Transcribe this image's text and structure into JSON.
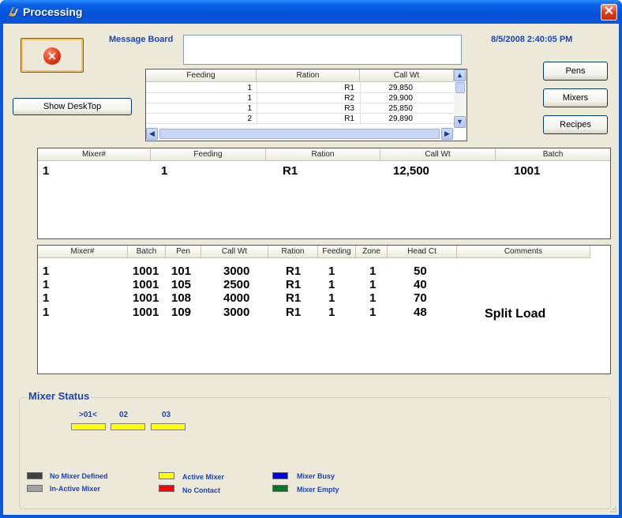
{
  "window": {
    "title": "Processing"
  },
  "datetime": "8/5/2008 2:40:05 PM",
  "message_board": {
    "label": "Message Board",
    "value": ""
  },
  "buttons": {
    "show_desktop": "Show DeskTop",
    "pens": "Pens",
    "mixers": "Mixers",
    "recipes": "Recipes"
  },
  "feeding_table": {
    "headers": [
      "Feeding",
      "Ration",
      "Call Wt"
    ],
    "rows": [
      [
        "1",
        "R1",
        "29,850"
      ],
      [
        "1",
        "R2",
        "29,900"
      ],
      [
        "1",
        "R3",
        "25,850"
      ],
      [
        "2",
        "R1",
        "29,890"
      ]
    ]
  },
  "mixer_table": {
    "headers": [
      "Mixer#",
      "Feeding",
      "Ration",
      "Call Wt",
      "Batch"
    ],
    "rows": [
      [
        "1",
        "1",
        "R1",
        "12,500",
        "1001"
      ]
    ]
  },
  "pen_table": {
    "headers": [
      "Mixer#",
      "Batch",
      "Pen",
      "Call Wt",
      "Ration",
      "Feeding",
      "Zone",
      "Head Ct",
      "Comments"
    ],
    "rows": [
      [
        "1",
        "1001",
        "101",
        "3000",
        "R1",
        "1",
        "1",
        "50",
        ""
      ],
      [
        "1",
        "1001",
        "105",
        "2500",
        "R1",
        "1",
        "1",
        "40",
        ""
      ],
      [
        "1",
        "1001",
        "108",
        "4000",
        "R1",
        "1",
        "1",
        "70",
        ""
      ],
      [
        "1",
        "1001",
        "109",
        "3000",
        "R1",
        "1",
        "1",
        "48",
        "Split Load"
      ]
    ]
  },
  "mixer_status": {
    "title": "Mixer Status",
    "mixers": [
      {
        "label": ">01<",
        "color": "#ffff00"
      },
      {
        "label": "02",
        "color": "#ffff00"
      },
      {
        "label": "03",
        "color": "#ffff00"
      }
    ],
    "legend": [
      {
        "label": "No Mixer Defined",
        "color": "#404040"
      },
      {
        "label": "In-Active Mixer",
        "color": "#a0a0a0"
      },
      {
        "label": "Active Mixer",
        "color": "#ffff00"
      },
      {
        "label": "No Contact",
        "color": "#ff0000"
      },
      {
        "label": "Mixer Busy",
        "color": "#0000e0"
      },
      {
        "label": "Mixer Empty",
        "color": "#007a20"
      }
    ]
  }
}
